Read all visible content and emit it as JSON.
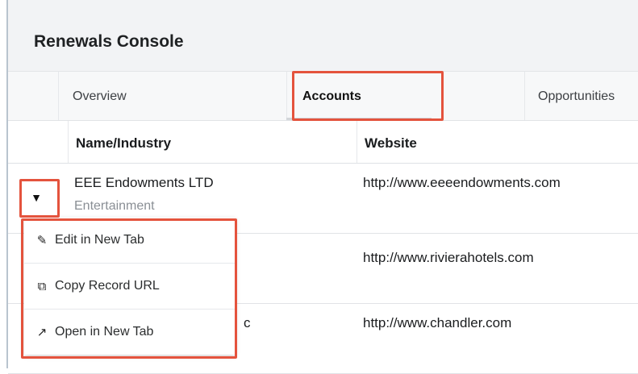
{
  "app": {
    "title": "Renewals Console"
  },
  "tabs": [
    {
      "label": "Overview"
    },
    {
      "label": "Accounts"
    },
    {
      "label": "Opportunities"
    }
  ],
  "table": {
    "columns": [
      "Name/Industry",
      "Website"
    ],
    "rows": [
      {
        "name": "EEE Endowments LTD",
        "industry": "Entertainment",
        "website": "http://www.eeeendowments.com"
      },
      {
        "name": "",
        "industry": "",
        "website": "http://www.rivierahotels.com"
      },
      {
        "name": "c",
        "industry": "",
        "website": "http://www.chandler.com"
      }
    ]
  },
  "context_menu": {
    "items": [
      {
        "label": "Edit in New Tab",
        "icon": "edit-icon"
      },
      {
        "label": "Copy Record URL",
        "icon": "copy-icon"
      },
      {
        "label": "Open in New Tab",
        "icon": "external-link-icon"
      }
    ]
  },
  "colors": {
    "highlight": "#e4533d",
    "header_bg": "#f2f3f5"
  }
}
